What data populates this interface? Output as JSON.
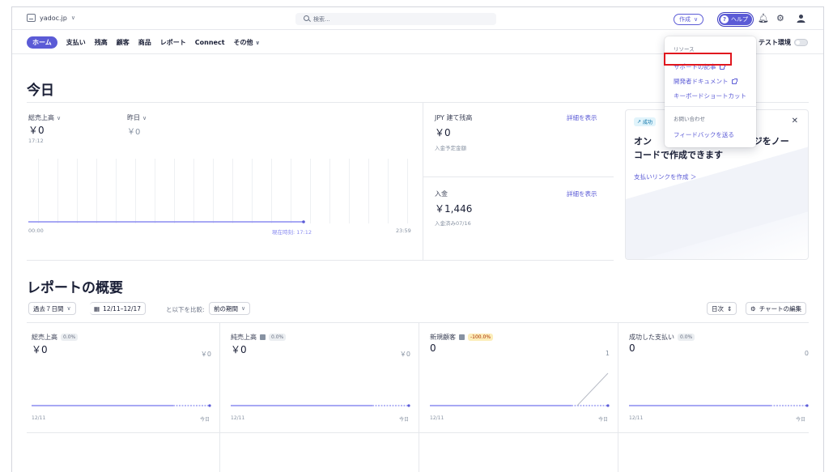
{
  "topbar": {
    "account": "yadoc.jp",
    "search_placeholder": "検索...",
    "create_label": "作成",
    "help_label": "ヘルプ"
  },
  "nav": {
    "items": [
      "ホーム",
      "支払い",
      "残高",
      "顧客",
      "商品",
      "レポート",
      "Connect",
      "その他"
    ],
    "test_env_label": "テスト環境"
  },
  "today": {
    "title": "今日",
    "gross_label": "総売上高",
    "gross_value": "￥0",
    "gross_time": "17:12",
    "yesterday_label": "昨日",
    "yesterday_value": "￥0",
    "axis_start": "00:00",
    "axis_now": "現在時刻: 17:12",
    "axis_end": "23:59",
    "jpy_label": "JPY 建て残高",
    "jpy_value": "￥0",
    "jpy_sub": "入金予定金額",
    "view_details": "詳細を表示",
    "payout_label": "入金",
    "payout_value": "￥1,446",
    "payout_sub": "入金済み07/16"
  },
  "promo": {
    "tag": "成功",
    "text_left": "オン",
    "text_right": "ぺージをノー",
    "text_line2": "コードで作成できます",
    "link": "支払いリンクを作成 ＞"
  },
  "report": {
    "title": "レポートの概要",
    "range": "過去７日間",
    "dates": "12/11–12/17",
    "compare_text": "と以下を比較:",
    "compare_value": "前の期間",
    "daily": "日次",
    "edit_charts": "チャートの編集",
    "cards": [
      {
        "title": "総売上高",
        "badge": "0.0%",
        "value": "￥0",
        "compare": "￥0",
        "x_start": "12/11",
        "x_end": "今日"
      },
      {
        "title": "純売上高",
        "badge": "0.0%",
        "value": "￥0",
        "compare": "￥0",
        "x_start": "12/11",
        "x_end": "今日"
      },
      {
        "title": "新規顧客",
        "badge": "-100.0%",
        "value": "0",
        "compare": "1",
        "x_start": "12/11",
        "x_end": "今日"
      },
      {
        "title": "成功した支払い",
        "badge": "0.0%",
        "value": "0",
        "compare": "0",
        "x_start": "12/11",
        "x_end": "今日"
      }
    ]
  },
  "dropdown": {
    "resources_heading": "リソース",
    "support_articles": "サポートの記事",
    "developer_docs": "開発者ドキュメント",
    "shortcuts": "キーボードショートカット",
    "contact_heading": "お問い合わせ",
    "feedback": "フィードバックを送る"
  },
  "colors": {
    "accent": "#5b5bd6",
    "highlight": "#e0161e"
  }
}
